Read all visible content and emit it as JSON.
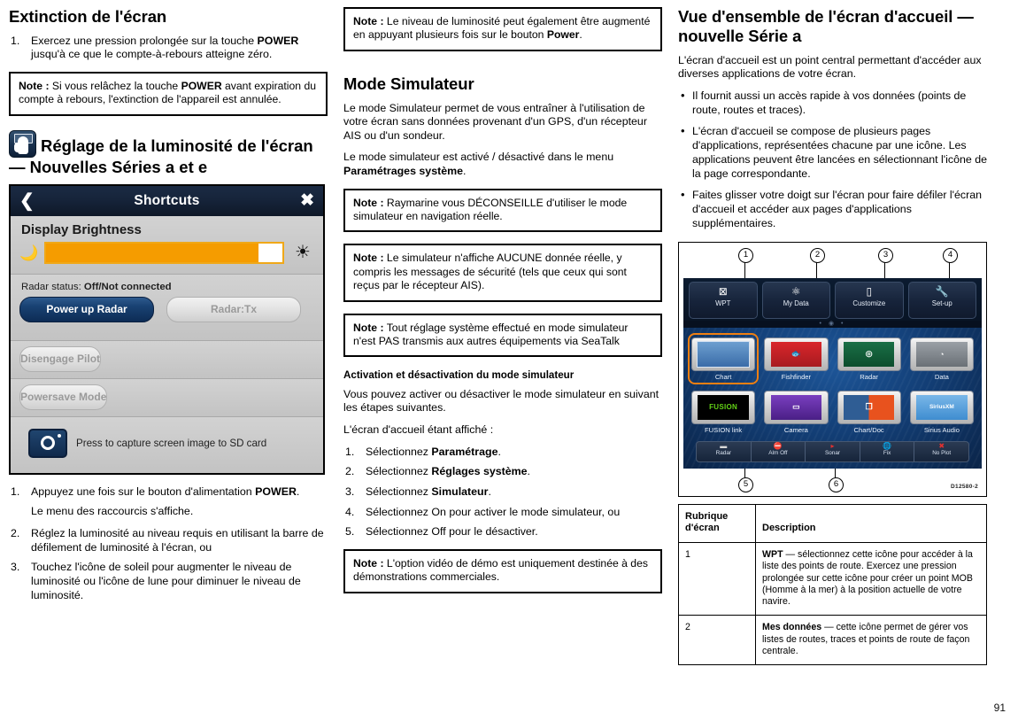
{
  "page_number": "91",
  "col1": {
    "heading": "Extinction de l'écran",
    "steps": [
      {
        "num": "1.",
        "parts": [
          {
            "t": "Exercez une pression prolongée sur la touche "
          },
          {
            "t": "POWER",
            "b": true
          },
          {
            "t": " jusqu'à ce que le compte-à-rebours atteigne zéro."
          }
        ]
      }
    ],
    "note1": {
      "label": "Note :",
      "parts": [
        {
          "t": " Si vous relâchez la touche "
        },
        {
          "t": "POWER",
          "b": true
        },
        {
          "t": " avant expiration du compte à rebours, l'extinction de l'appareil est annulée."
        }
      ]
    },
    "brightness_heading": "Réglage de la luminosité de l'écran — Nouvelles Séries a et e",
    "device": {
      "title": "Shortcuts",
      "back_icon": "back-chevron-icon",
      "close_icon": "close-icon",
      "brightness_label": "Display Brightness",
      "moon_icon": "moon-icon",
      "sun_icon": "sun-icon",
      "brightness_percent": 90,
      "radar_status_label": "Radar status:",
      "radar_status_value": "Off/Not connected",
      "power_up_radar": "Power up Radar",
      "radar_tx": "Radar:Tx",
      "disengage_pilot": "Disengage Pilot",
      "powersave_mode": "Powersave Mode",
      "camera_icon": "camera-icon",
      "capture_text": "Press to capture screen image to SD card"
    },
    "steps2": [
      {
        "num": "1.",
        "parts": [
          {
            "t": "Appuyez une fois sur le bouton d'alimentation "
          },
          {
            "t": "POWER",
            "b": true
          },
          {
            "t": "."
          }
        ]
      },
      {
        "num": "2.",
        "parts": [
          {
            "t": "Réglez la luminosité au niveau requis en utilisant la barre de défilement de luminosité à l'écran, ou"
          }
        ]
      },
      {
        "num": "3.",
        "parts": [
          {
            "t": "Touchez l'icône de soleil pour augmenter le niveau de luminosité ou l'icône de lune pour diminuer le niveau de luminosité."
          }
        ]
      }
    ],
    "sub_para": "Le menu des raccourcis s'affiche."
  },
  "col2": {
    "note_top": {
      "label": "Note :",
      "parts": [
        {
          "t": " Le niveau de luminosité peut également être augmenté en appuyant plusieurs fois sur le bouton "
        },
        {
          "t": "Power",
          "b": true
        },
        {
          "t": "."
        }
      ]
    },
    "heading": "Mode Simulateur",
    "para1": "Le mode Simulateur permet de vous entraîner à l'utilisation de votre écran sans données provenant d'un GPS, d'un récepteur AIS ou d'un sondeur.",
    "para2_parts": [
      {
        "t": "Le mode simulateur est activé / désactivé dans le menu "
      },
      {
        "t": "Paramétrages système",
        "b": true
      },
      {
        "t": "."
      }
    ],
    "note2": {
      "label": "Note :",
      "parts": [
        {
          "t": " Raymarine vous DÉCONSEILLE d'utiliser le mode simulateur en navigation réelle."
        }
      ]
    },
    "note3": {
      "label": "Note :",
      "parts": [
        {
          "t": " Le simulateur n'affiche AUCUNE donnée réelle, y compris les messages de sécurité (tels que ceux qui sont reçus par le récepteur AIS)."
        }
      ]
    },
    "note4": {
      "label": "Note :",
      "parts": [
        {
          "t": " Tout réglage système effectué en mode simulateur n'est PAS transmis aux autres équipements via SeaTalk"
        }
      ]
    },
    "subheading": "Activation et désactivation du mode simulateur",
    "para3": "Vous pouvez activer ou désactiver le mode simulateur en suivant les étapes suivantes.",
    "para4": "L'écran d'accueil étant affiché :",
    "steps": [
      {
        "num": "1.",
        "parts": [
          {
            "t": "Sélectionnez "
          },
          {
            "t": "Paramétrage",
            "b": true
          },
          {
            "t": "."
          }
        ]
      },
      {
        "num": "2.",
        "parts": [
          {
            "t": "Sélectionnez "
          },
          {
            "t": "Réglages système",
            "b": true
          },
          {
            "t": "."
          }
        ]
      },
      {
        "num": "3.",
        "parts": [
          {
            "t": "Sélectionnez "
          },
          {
            "t": "Simulateur",
            "b": true
          },
          {
            "t": "."
          }
        ]
      },
      {
        "num": "4.",
        "parts": [
          {
            "t": "Sélectionnez On pour activer le mode simulateur, ou"
          }
        ]
      },
      {
        "num": "5.",
        "parts": [
          {
            "t": "Sélectionnez Off pour le désactiver."
          }
        ]
      }
    ],
    "note5": {
      "label": "Note :",
      "parts": [
        {
          "t": " L'option vidéo de démo est uniquement destinée à des démonstrations commerciales."
        }
      ]
    }
  },
  "col3": {
    "heading": "Vue d'ensemble de l'écran d'accueil — nouvelle Série a",
    "para1": "L'écran d'accueil est un point central permettant d'accéder aux diverses applications de votre écran.",
    "bullets": [
      "Il fournit aussi un accès rapide à vos données (points de route, routes et traces).",
      "L'écran d'accueil se compose de plusieurs pages d'applications, représentées chacune par une icône.  Les applications peuvent être lancées en sélectionnant l'icône de la page correspondante.",
      "Faites glisser votre doigt sur l'écran pour faire défiler l'écran d'accueil et accéder aux pages d'applications supplémentaires."
    ],
    "figure": {
      "callouts": [
        "1",
        "2",
        "3",
        "4",
        "5",
        "6"
      ],
      "drawing_code": "D12580-2",
      "top_buttons": [
        {
          "label": "WPT",
          "icon": "waypoint-icon",
          "glyph": "⊠"
        },
        {
          "label": "My Data",
          "icon": "my-data-icon",
          "glyph": "⚛"
        },
        {
          "label": "Customize",
          "icon": "customize-icon",
          "glyph": "▯"
        },
        {
          "label": "Set-up",
          "icon": "wrench-icon",
          "glyph": "🔧"
        }
      ],
      "page_dots": "• ◉ •",
      "apps": [
        {
          "label": "Chart",
          "icon": "chart-app-icon",
          "selected": true
        },
        {
          "label": "Fishfinder",
          "icon": "fishfinder-app-icon",
          "selected": false
        },
        {
          "label": "Radar",
          "icon": "radar-app-icon",
          "selected": false
        },
        {
          "label": "Data",
          "icon": "data-app-icon",
          "selected": false
        },
        {
          "label": "FUSION link",
          "icon": "fusion-link-app-icon",
          "selected": false
        },
        {
          "label": "Camera",
          "icon": "camera-app-icon",
          "selected": false
        },
        {
          "label": "Chart/Doc",
          "icon": "chart-doc-app-icon",
          "selected": false
        },
        {
          "label": "Sirius Audio",
          "icon": "sirius-audio-app-icon",
          "selected": false
        }
      ],
      "fusion_wordmark": "FUSION",
      "sirius_wordmark": "SiriusXM",
      "status_items": [
        {
          "label": "Radar",
          "icon": "radar-status-icon"
        },
        {
          "label": "Alm Off",
          "icon": "alarm-off-icon"
        },
        {
          "label": "Sonar",
          "icon": "sonar-status-icon"
        },
        {
          "label": "Fix",
          "icon": "fix-status-icon"
        },
        {
          "label": "No Plot",
          "icon": "no-plot-icon"
        }
      ]
    },
    "table": {
      "headers": [
        "Rubrique d'écran",
        "Description"
      ],
      "header1_line1": "Rubrique",
      "header1_line2": "d'écran",
      "rows": [
        {
          "item": "1",
          "parts": [
            {
              "t": "WPT",
              "b": true
            },
            {
              "t": " — sélectionnez cette icône pour accéder à la liste des points de route. Exercez une pression prolongée sur cette icône pour créer un point MOB (Homme à la mer) à la position actuelle de votre navire."
            }
          ]
        },
        {
          "item": "2",
          "parts": [
            {
              "t": "Mes données",
              "b": true
            },
            {
              "t": " — cette icône permet de gérer vos listes de routes, traces et points de route de façon centrale."
            }
          ]
        }
      ]
    }
  }
}
